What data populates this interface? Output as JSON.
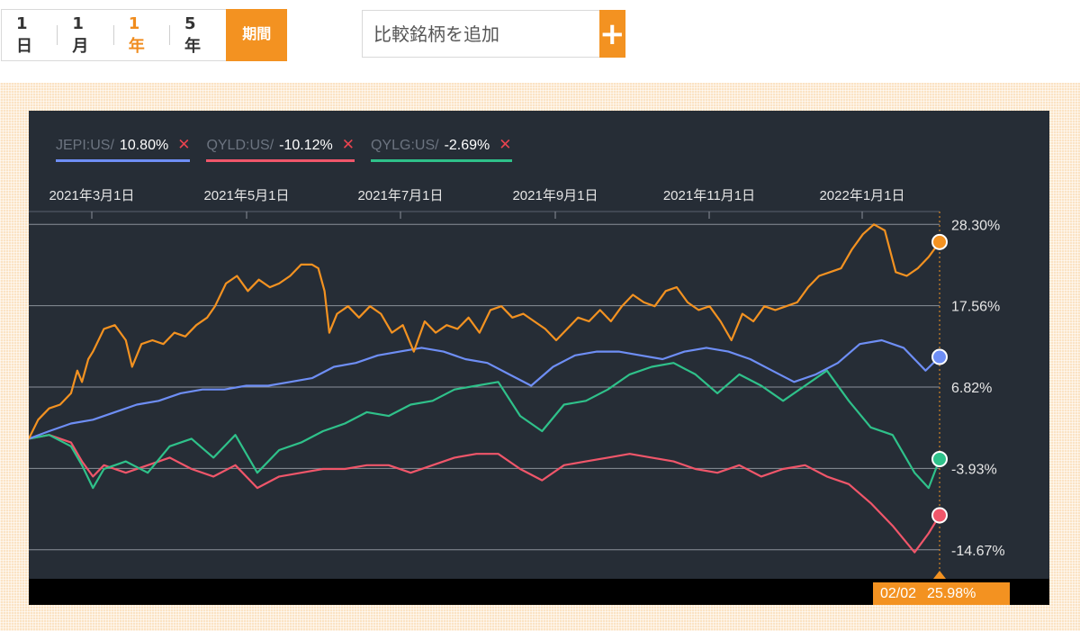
{
  "controls": {
    "ranges": [
      "1日",
      "1月",
      "1年",
      "5年"
    ],
    "active_range": "1年",
    "period_label": "期間",
    "compare_placeholder": "比較銘柄を追加",
    "compare_add_label": "+"
  },
  "colors": {
    "accent": "#f39221",
    "chart_bg": "#262d36",
    "main_line": "#f39221",
    "jepi": "#6e8ef5",
    "qyld": "#f0566a",
    "qylg": "#2fc18a",
    "remove_x": "#e8434f"
  },
  "legend": [
    {
      "symbol": "JEPI:US",
      "separator": " /",
      "value": "10.80%",
      "remove_icon": "close-icon",
      "color": "#6e8ef5"
    },
    {
      "symbol": "QYLD:US",
      "separator": " /",
      "value": "-10.12%",
      "remove_icon": "close-icon",
      "color": "#f0566a"
    },
    {
      "symbol": "QYLG:US",
      "separator": " /",
      "value": "-2.69%",
      "remove_icon": "close-icon",
      "color": "#2fc18a"
    }
  ],
  "tooltip": {
    "date": "02/02",
    "value": "25.98%"
  },
  "chart_data": {
    "type": "line",
    "x_tick_labels": [
      "2021年3月1日",
      "2021年5月1日",
      "2021年7月1日",
      "2021年9月1日",
      "2021年11月1日",
      "2022年1月1日"
    ],
    "x_tick_dates": [
      "2021-03-01",
      "2021-05-01",
      "2021-07-01",
      "2021-09-01",
      "2021-11-01",
      "2022-01-01"
    ],
    "x_range": [
      "2021-02-02",
      "2022-02-02"
    ],
    "y_tick_labels": [
      "28.30%",
      "17.56%",
      "6.82%",
      "-3.93%",
      "-14.67%"
    ],
    "y_ticks": [
      28.3,
      17.56,
      6.82,
      -3.93,
      -14.67
    ],
    "ylim": [
      -18.5,
      30
    ],
    "grid": "horizontal",
    "series": [
      {
        "color": "#f39221",
        "last": 25.98,
        "points": [
          [
            "2021-02-02",
            0.0
          ],
          [
            "2021-02-08",
            2.5
          ],
          [
            "2021-02-15",
            4.0
          ],
          [
            "2021-02-22",
            4.5
          ],
          [
            "2021-03-01",
            6.0
          ],
          [
            "2021-03-05",
            9.0
          ],
          [
            "2021-03-08",
            7.5
          ],
          [
            "2021-03-12",
            10.5
          ],
          [
            "2021-03-15",
            11.5
          ],
          [
            "2021-03-22",
            14.5
          ],
          [
            "2021-03-29",
            15.0
          ],
          [
            "2021-04-05",
            13.0
          ],
          [
            "2021-04-09",
            9.5
          ],
          [
            "2021-04-15",
            12.5
          ],
          [
            "2021-04-22",
            13.0
          ],
          [
            "2021-04-29",
            12.5
          ],
          [
            "2021-05-06",
            14.0
          ],
          [
            "2021-05-13",
            13.5
          ],
          [
            "2021-05-20",
            15.0
          ],
          [
            "2021-05-27",
            16.0
          ],
          [
            "2021-06-01",
            17.5
          ],
          [
            "2021-06-08",
            20.5
          ],
          [
            "2021-06-15",
            21.5
          ],
          [
            "2021-06-22",
            19.5
          ],
          [
            "2021-06-29",
            21.0
          ],
          [
            "2021-07-06",
            20.0
          ],
          [
            "2021-07-12",
            20.5
          ],
          [
            "2021-07-19",
            21.5
          ],
          [
            "2021-07-26",
            23.0
          ],
          [
            "2021-08-02",
            23.0
          ],
          [
            "2021-08-06",
            22.5
          ],
          [
            "2021-08-10",
            19.5
          ],
          [
            "2021-08-13",
            14.0
          ],
          [
            "2021-08-18",
            16.5
          ],
          [
            "2021-08-25",
            17.5
          ],
          [
            "2021-09-01",
            16.0
          ],
          [
            "2021-09-08",
            17.5
          ],
          [
            "2021-09-15",
            16.5
          ],
          [
            "2021-09-22",
            14.0
          ],
          [
            "2021-09-29",
            15.0
          ],
          [
            "2021-10-06",
            11.5
          ],
          [
            "2021-10-13",
            15.5
          ],
          [
            "2021-10-20",
            14.0
          ],
          [
            "2021-10-27",
            15.0
          ],
          [
            "2021-11-03",
            14.5
          ],
          [
            "2021-11-10",
            16.0
          ],
          [
            "2021-11-17",
            14.0
          ],
          [
            "2021-11-24",
            17.0
          ],
          [
            "2021-12-01",
            17.5
          ],
          [
            "2021-12-08",
            16.0
          ],
          [
            "2021-12-15",
            16.5
          ],
          [
            "2021-12-22",
            15.5
          ],
          [
            "2021-12-29",
            14.5
          ],
          [
            "2022-01-05",
            13.0
          ],
          [
            "2022-01-12",
            14.5
          ],
          [
            "2022-01-19",
            16.0
          ],
          [
            "2022-01-26",
            15.5
          ],
          [
            "2022-02-02",
            17.0
          ],
          [
            "2022-02-09",
            15.5
          ],
          [
            "2022-02-16",
            17.5
          ],
          [
            "2022-02-23",
            19.0
          ],
          [
            "2022-03-02",
            18.0
          ],
          [
            "2022-03-09",
            17.5
          ],
          [
            "2022-03-16",
            19.5
          ],
          [
            "2022-03-23",
            20.0
          ],
          [
            "2022-03-30",
            18.0
          ],
          [
            "2022-04-06",
            17.0
          ],
          [
            "2022-04-13",
            17.5
          ],
          [
            "2022-04-20",
            15.5
          ],
          [
            "2022-04-27",
            13.0
          ],
          [
            "2022-05-04",
            16.5
          ],
          [
            "2022-05-11",
            15.5
          ],
          [
            "2022-05-18",
            17.5
          ],
          [
            "2022-05-25",
            17.0
          ],
          [
            "2022-06-01",
            17.5
          ],
          [
            "2022-06-08",
            18.0
          ],
          [
            "2022-06-15",
            20.0
          ],
          [
            "2022-06-22",
            21.5
          ],
          [
            "2022-06-29",
            22.0
          ],
          [
            "2022-07-06",
            22.5
          ],
          [
            "2022-07-13",
            25.0
          ],
          [
            "2022-07-20",
            27.0
          ],
          [
            "2022-07-27",
            28.3
          ],
          [
            "2022-08-03",
            27.5
          ],
          [
            "2022-08-10",
            22.0
          ],
          [
            "2022-08-17",
            21.5
          ],
          [
            "2022-08-24",
            22.5
          ],
          [
            "2022-08-31",
            24.0
          ],
          [
            "2022-09-07",
            25.98
          ]
        ]
      },
      {
        "name": "JEPI:US",
        "color": "#6e8ef5",
        "last": 10.8,
        "points": [
          [
            "2021-02-02",
            0.0
          ],
          [
            "2021-02-15",
            1.0
          ],
          [
            "2021-03-01",
            2.0
          ],
          [
            "2021-03-15",
            2.5
          ],
          [
            "2021-03-29",
            3.5
          ],
          [
            "2021-04-12",
            4.5
          ],
          [
            "2021-04-26",
            5.0
          ],
          [
            "2021-05-10",
            6.0
          ],
          [
            "2021-05-24",
            6.5
          ],
          [
            "2021-06-07",
            6.5
          ],
          [
            "2021-06-21",
            7.0
          ],
          [
            "2021-07-05",
            7.0
          ],
          [
            "2021-07-19",
            7.5
          ],
          [
            "2021-08-02",
            8.0
          ],
          [
            "2021-08-16",
            9.5
          ],
          [
            "2021-08-30",
            10.0
          ],
          [
            "2021-09-13",
            11.0
          ],
          [
            "2021-09-27",
            11.5
          ],
          [
            "2021-10-11",
            12.0
          ],
          [
            "2021-10-25",
            11.5
          ],
          [
            "2021-11-08",
            10.5
          ],
          [
            "2021-11-22",
            10.0
          ],
          [
            "2021-12-06",
            8.5
          ],
          [
            "2021-12-20",
            7.0
          ],
          [
            "2022-01-03",
            9.5
          ],
          [
            "2022-01-17",
            11.0
          ],
          [
            "2022-01-31",
            11.5
          ],
          [
            "2022-02-14",
            11.5
          ],
          [
            "2022-02-28",
            11.0
          ],
          [
            "2022-03-14",
            10.5
          ],
          [
            "2022-03-28",
            11.5
          ],
          [
            "2022-04-11",
            12.0
          ],
          [
            "2022-04-25",
            11.5
          ],
          [
            "2022-05-09",
            10.5
          ],
          [
            "2022-05-23",
            9.0
          ],
          [
            "2022-06-06",
            7.5
          ],
          [
            "2022-06-20",
            8.5
          ],
          [
            "2022-07-04",
            10.0
          ],
          [
            "2022-07-18",
            12.5
          ],
          [
            "2022-08-01",
            13.0
          ],
          [
            "2022-08-15",
            12.0
          ],
          [
            "2022-08-29",
            9.0
          ],
          [
            "2022-09-07",
            10.8
          ]
        ]
      },
      {
        "name": "QYLD:US",
        "color": "#f0566a",
        "last": -10.12,
        "points": [
          [
            "2021-02-02",
            0.0
          ],
          [
            "2021-02-15",
            0.5
          ],
          [
            "2021-03-01",
            -0.5
          ],
          [
            "2021-03-08",
            -3.0
          ],
          [
            "2021-03-15",
            -5.0
          ],
          [
            "2021-03-22",
            -3.5
          ],
          [
            "2021-04-05",
            -4.5
          ],
          [
            "2021-04-19",
            -3.5
          ],
          [
            "2021-05-03",
            -2.5
          ],
          [
            "2021-05-17",
            -4.0
          ],
          [
            "2021-05-31",
            -5.0
          ],
          [
            "2021-06-14",
            -3.5
          ],
          [
            "2021-06-28",
            -6.5
          ],
          [
            "2021-07-12",
            -5.0
          ],
          [
            "2021-07-26",
            -4.5
          ],
          [
            "2021-08-09",
            -4.0
          ],
          [
            "2021-08-23",
            -4.0
          ],
          [
            "2021-09-06",
            -3.5
          ],
          [
            "2021-09-20",
            -3.5
          ],
          [
            "2021-10-04",
            -4.5
          ],
          [
            "2021-10-18",
            -3.5
          ],
          [
            "2021-11-01",
            -2.5
          ],
          [
            "2021-11-15",
            -2.0
          ],
          [
            "2021-11-29",
            -2.0
          ],
          [
            "2021-12-13",
            -4.0
          ],
          [
            "2021-12-27",
            -5.5
          ],
          [
            "2022-01-10",
            -3.5
          ],
          [
            "2022-01-24",
            -3.0
          ],
          [
            "2022-02-07",
            -2.5
          ],
          [
            "2022-02-21",
            -2.0
          ],
          [
            "2022-03-07",
            -2.5
          ],
          [
            "2022-03-21",
            -3.0
          ],
          [
            "2022-04-04",
            -4.0
          ],
          [
            "2022-04-18",
            -4.5
          ],
          [
            "2022-05-02",
            -3.5
          ],
          [
            "2022-05-16",
            -5.0
          ],
          [
            "2022-05-30",
            -4.0
          ],
          [
            "2022-06-13",
            -3.5
          ],
          [
            "2022-06-27",
            -5.0
          ],
          [
            "2022-07-11",
            -6.0
          ],
          [
            "2022-07-25",
            -8.5
          ],
          [
            "2022-08-08",
            -11.5
          ],
          [
            "2022-08-22",
            -15.0
          ],
          [
            "2022-08-31",
            -12.5
          ],
          [
            "2022-09-07",
            -10.12
          ]
        ]
      },
      {
        "name": "QYLG:US",
        "color": "#2fc18a",
        "last": -2.69,
        "points": [
          [
            "2021-02-02",
            0.0
          ],
          [
            "2021-02-15",
            0.5
          ],
          [
            "2021-03-01",
            -1.0
          ],
          [
            "2021-03-08",
            -3.5
          ],
          [
            "2021-03-15",
            -6.5
          ],
          [
            "2021-03-22",
            -4.0
          ],
          [
            "2021-04-05",
            -3.0
          ],
          [
            "2021-04-19",
            -4.5
          ],
          [
            "2021-05-03",
            -1.0
          ],
          [
            "2021-05-17",
            0.0
          ],
          [
            "2021-05-31",
            -2.5
          ],
          [
            "2021-06-14",
            0.5
          ],
          [
            "2021-06-28",
            -4.5
          ],
          [
            "2021-07-12",
            -1.5
          ],
          [
            "2021-07-26",
            -0.5
          ],
          [
            "2021-08-09",
            1.0
          ],
          [
            "2021-08-23",
            2.0
          ],
          [
            "2021-09-06",
            3.5
          ],
          [
            "2021-09-20",
            3.0
          ],
          [
            "2021-10-04",
            4.5
          ],
          [
            "2021-10-18",
            5.0
          ],
          [
            "2021-11-01",
            6.5
          ],
          [
            "2021-11-15",
            7.0
          ],
          [
            "2021-11-29",
            7.5
          ],
          [
            "2021-12-13",
            3.0
          ],
          [
            "2021-12-27",
            1.0
          ],
          [
            "2022-01-10",
            4.5
          ],
          [
            "2022-01-24",
            5.0
          ],
          [
            "2022-02-07",
            6.5
          ],
          [
            "2022-02-21",
            8.5
          ],
          [
            "2022-03-07",
            9.5
          ],
          [
            "2022-03-21",
            10.0
          ],
          [
            "2022-04-04",
            8.5
          ],
          [
            "2022-04-18",
            6.0
          ],
          [
            "2022-05-02",
            8.5
          ],
          [
            "2022-05-16",
            7.0
          ],
          [
            "2022-05-30",
            5.0
          ],
          [
            "2022-06-13",
            7.0
          ],
          [
            "2022-06-27",
            9.0
          ],
          [
            "2022-07-11",
            5.0
          ],
          [
            "2022-07-25",
            1.5
          ],
          [
            "2022-08-08",
            0.5
          ],
          [
            "2022-08-22",
            -4.5
          ],
          [
            "2022-08-31",
            -6.5
          ],
          [
            "2022-09-07",
            -2.69
          ]
        ]
      }
    ]
  }
}
